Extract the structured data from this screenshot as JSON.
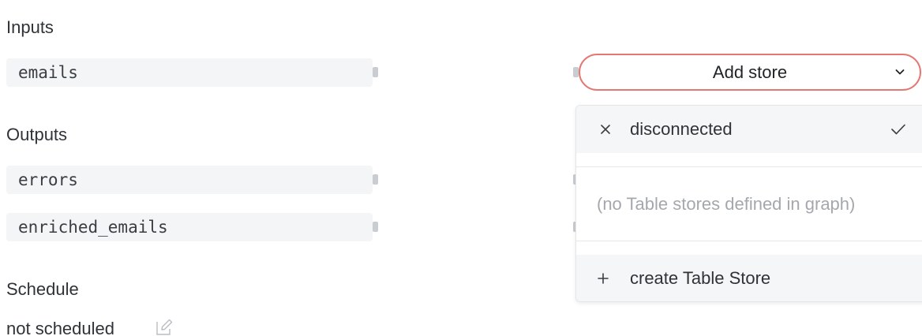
{
  "inputs": {
    "heading": "Inputs",
    "ports": [
      {
        "name": "emails"
      }
    ]
  },
  "outputs": {
    "heading": "Outputs",
    "ports": [
      {
        "name": "errors"
      },
      {
        "name": "enriched_emails"
      }
    ]
  },
  "schedule": {
    "heading": "Schedule",
    "value": "not scheduled",
    "edit_icon": "edit-icon"
  },
  "store_select": {
    "label": "Add store",
    "icon": "chevron-down-icon",
    "border_color": "#e37873"
  },
  "dropdown": {
    "selected_option": {
      "label": "disconnected",
      "leading_icon": "x-icon",
      "trailing_icon": "check-icon"
    },
    "empty_message": "(no Table stores defined in graph)",
    "create_option": {
      "label": "create Table Store",
      "icon": "plus-icon"
    }
  }
}
